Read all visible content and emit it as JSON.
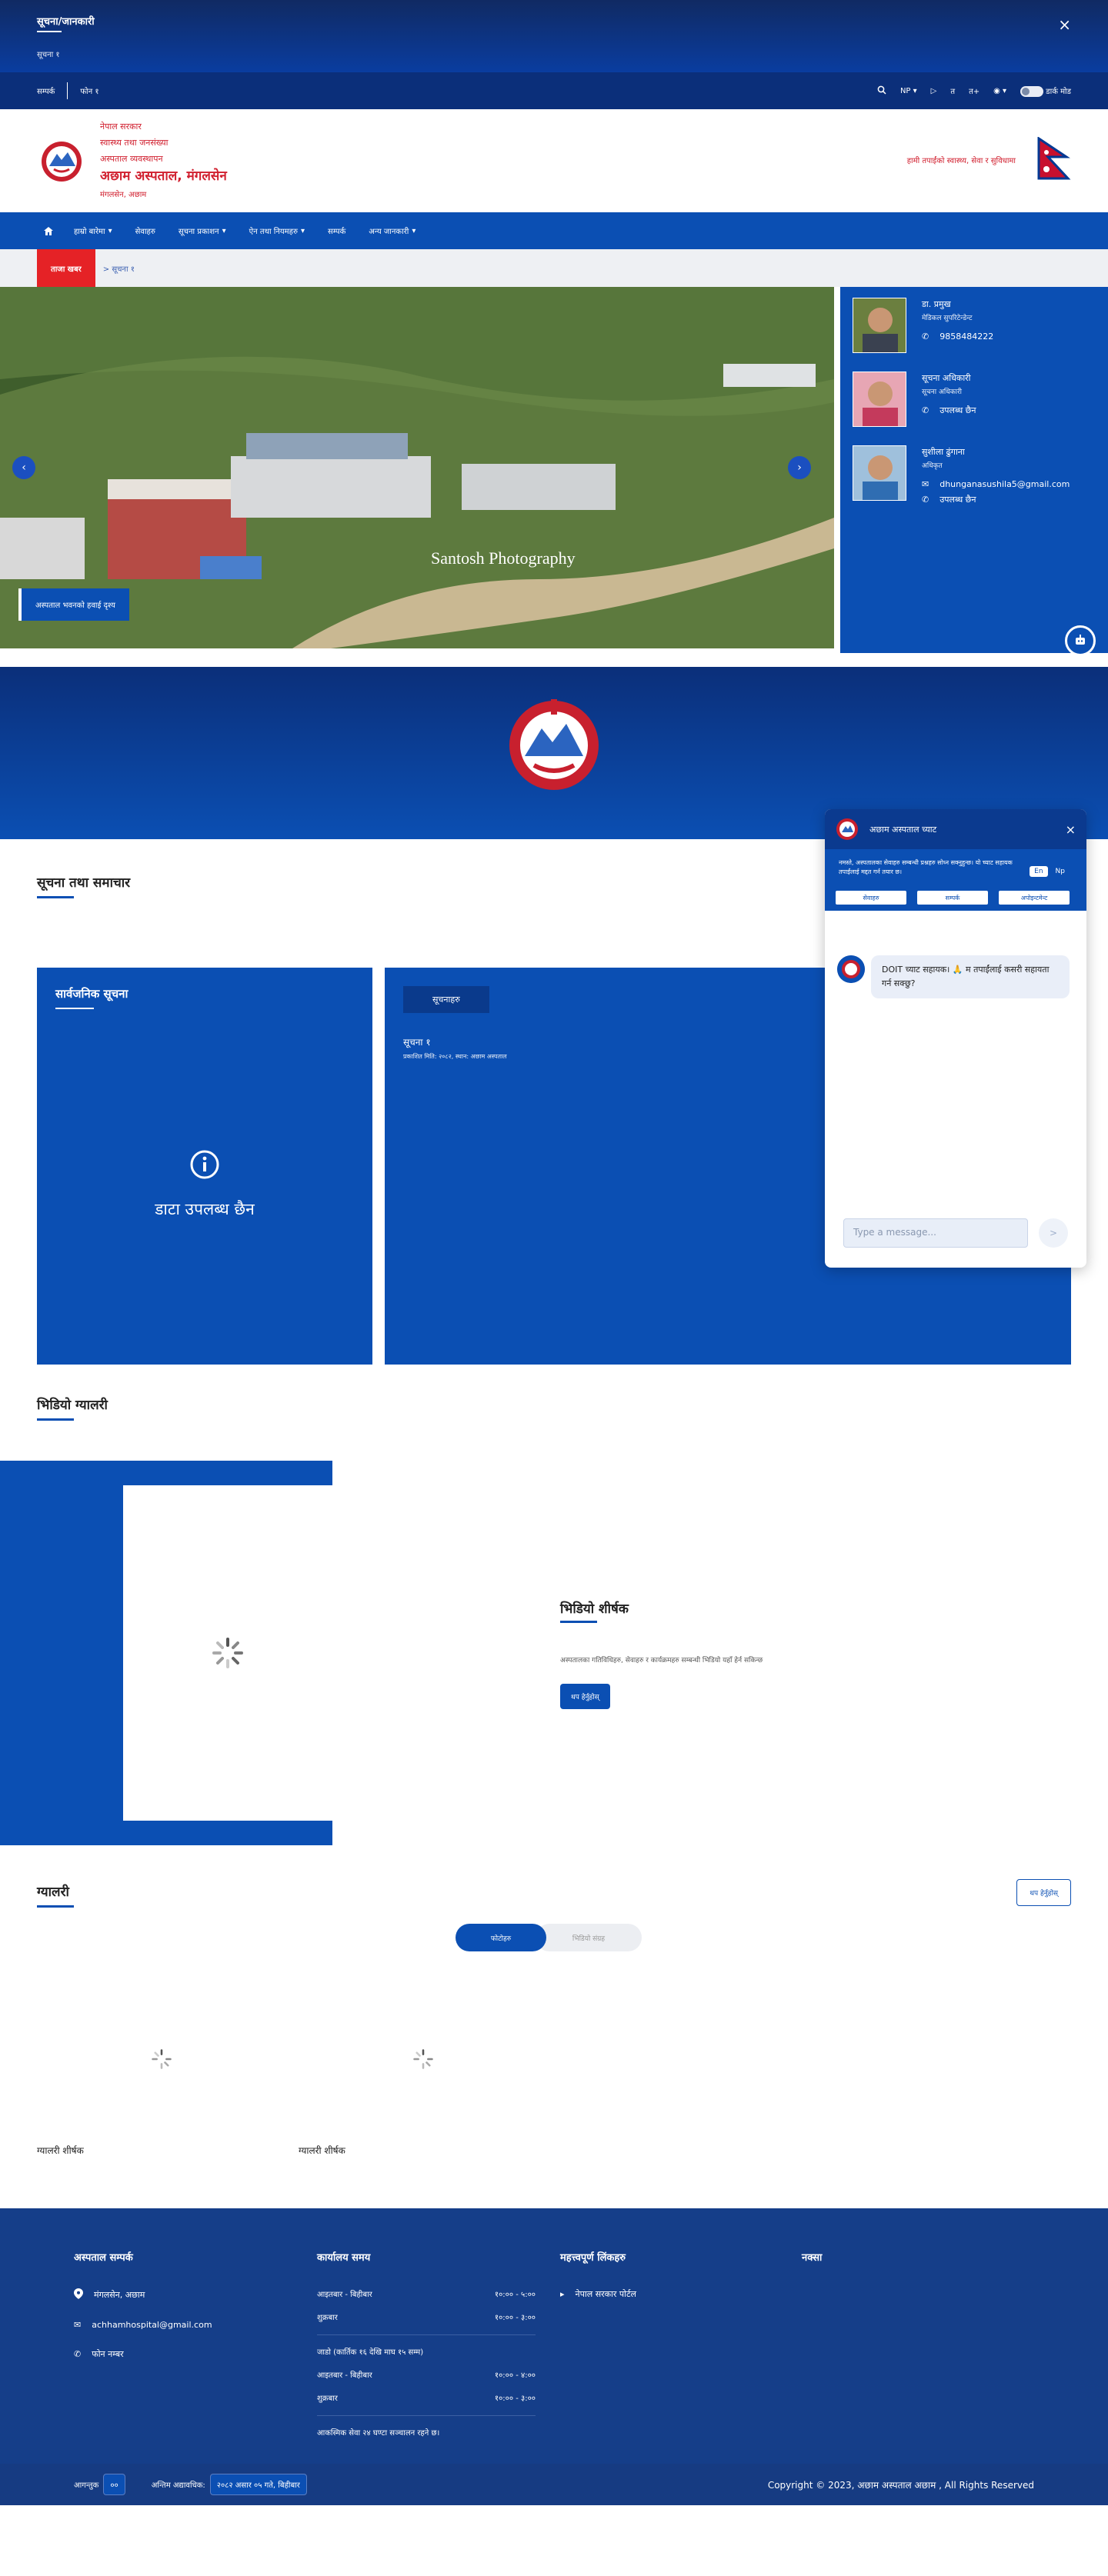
{
  "notice": {
    "title": "सूचना/जानकारी",
    "subtitle": "सूचना १",
    "close": "×"
  },
  "topbar": {
    "left1": "सम्पर्क",
    "left2": "फोन १",
    "lang": "NP",
    "a_small": "▷",
    "a_mid": "त",
    "a_plus": "त+",
    "theme_toggle_label": "डार्क मोड"
  },
  "header": {
    "line1": "नेपाल सरकार",
    "line2": "स्वास्थ्य तथा जनसंख्या",
    "line3": "अस्पताल व्यवस्थापन",
    "name": "अछाम अस्पताल, मंगलसेन",
    "address": "मंगलसेन, अछाम",
    "right_text": "हामी तपाईंको स्वास्थ्य, सेवा र सुविधामा"
  },
  "nav": {
    "items": [
      "हाम्रो बारेमा",
      "सेवाहरु",
      "सूचना प्रकाशन",
      "ऐन तथा नियमहरु",
      "सम्पर्क",
      "अन्य जानकारी"
    ]
  },
  "breadcrumb": {
    "label": "ताजा खबर",
    "path": "> सूचना १"
  },
  "hero": {
    "caption": "अस्पताल भवनको हवाई दृश्य",
    "watermark": "Santosh Photography",
    "officials": [
      {
        "name": "डा. प्रमुख",
        "role": "मेडिकल सुपरिटेन्डेन्ट",
        "phone": "9858484222"
      },
      {
        "name": "सूचना अधिकारी",
        "role": "सूचना अधिकारी",
        "phone": "उपलब्ध छैन"
      },
      {
        "name": "सुशीला ढुंगाना",
        "role": "अधिकृत",
        "email": "dhunganasushila5@gmail.com",
        "phone": "उपलब्ध छैन"
      }
    ]
  },
  "sections": {
    "notices_title": "सूचना तथा समाचार",
    "card1_title": "सार्वजनिक सूचना",
    "card1_empty": "डाटा उपलब्ध छैन",
    "card2_tab": "सूचनाहरु",
    "card2_item_title": "सूचना १",
    "card2_item_meta": "प्रकाशित मिति: २०८२, स्थान: अछाम अस्पताल",
    "video_section_title": "भिडियो ग्यालरी",
    "video_title": "भिडियो शीर्षक",
    "video_desc": "अस्पतालका गतिविधिहरु, सेवाहरु र कार्यक्रमहरु सम्बन्धी भिडियो यहाँ हेर्न सकिन्छ",
    "video_button": "थप हेर्नुहोस्",
    "gallery_title": "ग्यालरी",
    "gallery_more": "थप हेर्नुहोस्",
    "tab_photos": "फोटोहरु",
    "tab_videos": "भिडियो संग्रह",
    "gallery_item1": "ग्यालरी शीर्षक",
    "gallery_item2": "ग्यालरी शीर्षक"
  },
  "chat": {
    "title": "अछाम अस्पताल च्याट",
    "intro": "नमस्ते, अस्पतालका सेवाहरु सम्बन्धी प्रश्नहरु सोध्न सक्नुहुन्छ। यो च्याट सहायक तपाईंलाई मद्दत गर्न तयार छ।",
    "lang_en": "En",
    "lang_np": "Np",
    "quick": [
      "सेवाहरु",
      "सम्पर्क",
      "अपोइन्टमेन्ट"
    ],
    "message": "DOIT च्याट सहायक। 🙏 म तपाईंलाई कसरी सहायता गर्न सक्छु?",
    "placeholder": "Type a message...",
    "send": ">"
  },
  "footer": {
    "col1_title": "अस्पताल सम्पर्क",
    "address": "मंगलसेन, अछाम",
    "email": "achhamhospital@gmail.com",
    "phone": "फोन नम्बर",
    "col2_title": "कार्यालय समय",
    "hours": [
      {
        "d": "आइतबार - बिहीबार",
        "t": "१०:०० - ५:००"
      },
      {
        "d": "शुक्रबार",
        "t": "१०:०० - ३:००"
      }
    ],
    "hours_note": "जाडो (कार्तिक १६ देखि माघ १५ सम्म)",
    "hours2": [
      {
        "d": "आइतबार - बिहीबार",
        "t": "१०:०० - ४:००"
      },
      {
        "d": "शुक्रबार",
        "t": "१०:०० - ३:००"
      }
    ],
    "hours_footer": "आकस्मिक सेवा २४ घण्टा सञ्चालन रहने छ।",
    "col3_title": "महत्त्वपूर्ण लिंकहरु",
    "link1": "नेपाल सरकार पोर्टल",
    "col4_title": "नक्सा",
    "visitors_label": "आगन्तुक",
    "visitors": "००",
    "updated_label": "अन्तिम अद्यावधिक:",
    "updated": "२०८२ असार ०५ गते, बिहीबार",
    "copyright": "Copyright © 2023, अछाम अस्पताल अछाम , All Rights Reserved"
  }
}
